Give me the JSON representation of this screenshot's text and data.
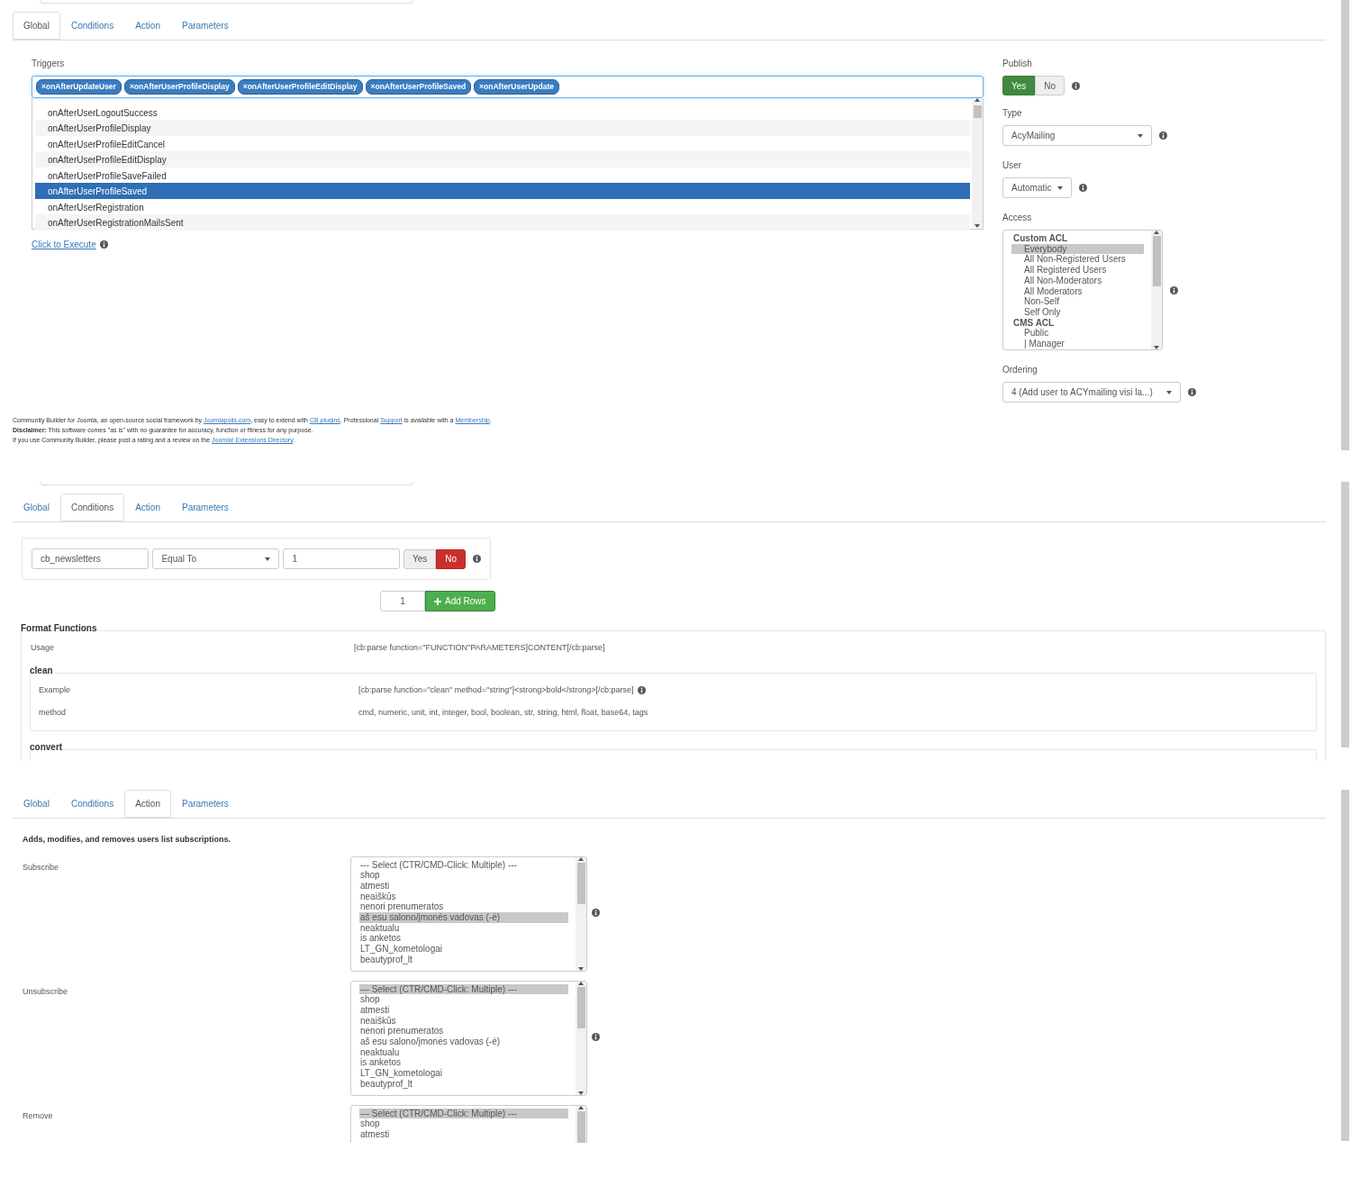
{
  "global_panel": {
    "tabs": [
      {
        "label": "Global",
        "selected": true
      },
      {
        "label": "Conditions",
        "selected": false
      },
      {
        "label": "Action",
        "selected": false
      },
      {
        "label": "Parameters",
        "selected": false
      }
    ],
    "triggers": {
      "label": "Triggers",
      "tags": [
        "×onAfterUpdateUser",
        "×onAfterUserProfileDisplay",
        "×onAfterUserProfileEditDisplay",
        "×onAfterUserProfileSaved",
        "×onAfterUserUpdate"
      ],
      "options": [
        {
          "label": "onAfterUserLogoutSuccess",
          "selected": false
        },
        {
          "label": "onAfterUserProfileDisplay",
          "selected": false
        },
        {
          "label": "onAfterUserProfileEditCancel",
          "selected": false
        },
        {
          "label": "onAfterUserProfileEditDisplay",
          "selected": false
        },
        {
          "label": "onAfterUserProfileSaveFailed",
          "selected": false
        },
        {
          "label": "onAfterUserProfileSaved",
          "selected": true
        },
        {
          "label": "onAfterUserRegistration",
          "selected": false
        },
        {
          "label": "onAfterUserRegistrationMailsSent",
          "selected": false
        }
      ]
    },
    "execute_link": "Click to Execute",
    "publish": {
      "label": "Publish",
      "options": [
        {
          "label": "Yes",
          "selected": true
        },
        {
          "label": "No",
          "selected": false
        }
      ]
    },
    "type": {
      "label": "Type",
      "value": "AcyMailing"
    },
    "user": {
      "label": "User",
      "value": "Automatic"
    },
    "access": {
      "label": "Access",
      "groups": [
        {
          "label": "Custom ACL",
          "options": [
            {
              "label": "Everybody",
              "selected": true
            },
            {
              "label": "All Non-Registered Users",
              "selected": false
            },
            {
              "label": "All Registered Users",
              "selected": false
            },
            {
              "label": "All Non-Moderators",
              "selected": false
            },
            {
              "label": "All Moderators",
              "selected": false
            },
            {
              "label": "Non-Self",
              "selected": false
            },
            {
              "label": "Self Only",
              "selected": false
            }
          ]
        },
        {
          "label": "CMS ACL",
          "options": [
            {
              "label": "Public",
              "selected": false
            },
            {
              "label": "| Manager",
              "selected": false
            }
          ]
        }
      ]
    },
    "ordering": {
      "label": "Ordering",
      "value": "4 (Add user to ACYmailing visi la...)"
    },
    "footer": [
      [
        {
          "kind": "text",
          "text": "Community Builder for Joomla, an open-source social framework by "
        },
        {
          "kind": "link",
          "text": "Joomlapolis.com"
        },
        {
          "kind": "text",
          "text": ", easy to extend with "
        },
        {
          "kind": "link",
          "text": "CB plugins"
        },
        {
          "kind": "text",
          "text": ". Professional "
        },
        {
          "kind": "link",
          "text": "Support"
        },
        {
          "kind": "text",
          "text": " is available with a "
        },
        {
          "kind": "link",
          "text": "Membership"
        },
        {
          "kind": "text",
          "text": "."
        }
      ],
      [
        {
          "kind": "text",
          "text": "**Disclaimer:** This software comes \"as is\" with no guarantee for accuracy, function or fitness for any purpose."
        }
      ],
      [
        {
          "kind": "text",
          "text": "If you use Community Builder, please post a rating and a review on the "
        },
        {
          "kind": "link",
          "text": "Joomla! Extensions Directory"
        },
        {
          "kind": "text",
          "text": "."
        }
      ]
    ]
  },
  "conditions_panel": {
    "tabs": [
      {
        "label": "Global",
        "selected": false
      },
      {
        "label": "Conditions",
        "selected": true
      },
      {
        "label": "Action",
        "selected": false
      },
      {
        "label": "Parameters",
        "selected": false
      }
    ],
    "condition": {
      "field": "cb_newsletters",
      "operator": "Equal To",
      "value": "1",
      "toggle": [
        {
          "label": "Yes",
          "selected": false
        },
        {
          "label": "No",
          "selected": true
        }
      ]
    },
    "add_rows": {
      "count": "1",
      "label": "Add Rows"
    },
    "format_functions": {
      "title": "Format Functions",
      "usage_label": "Usage",
      "usage_value": "[cb:parse function=\"FUNCTION\"PARAMETERS]CONTENT[/cb:parse]",
      "groups": [
        {
          "title": "clean",
          "rows": [
            {
              "label": "Example",
              "value": "[cb:parse function=\"clean\" method=\"string\"]<strong>bold</strong>[/cb:parse]",
              "info": true
            },
            {
              "label": "method",
              "value": "cmd, numeric, unit, int, integer, bool, boolean, str, string, html, float, base64, tags",
              "info": false
            }
          ]
        },
        {
          "title": "convert"
        }
      ]
    }
  },
  "action_panel": {
    "tabs": [
      {
        "label": "Global",
        "selected": false
      },
      {
        "label": "Conditions",
        "selected": false
      },
      {
        "label": "Action",
        "selected": true
      },
      {
        "label": "Parameters",
        "selected": false
      }
    ],
    "description": "Adds, modifies, and removes users list subscriptions.",
    "lists": [
      {
        "label": "Subscribe",
        "options": [
          {
            "label": "--- Select (CTR/CMD-Click: Multiple) ---",
            "selected": false
          },
          {
            "label": "shop",
            "selected": false
          },
          {
            "label": "atmesti",
            "selected": false
          },
          {
            "label": "neaiškūs",
            "selected": false
          },
          {
            "label": "nenori prenumeratos",
            "selected": false
          },
          {
            "label": "aš esu salono/įmonės vadovas (-ė)",
            "selected": true
          },
          {
            "label": "neaktualu",
            "selected": false
          },
          {
            "label": "is anketos",
            "selected": false
          },
          {
            "label": "LT_GN_kometologai",
            "selected": false
          },
          {
            "label": "beautyprof_lt",
            "selected": false
          }
        ]
      },
      {
        "label": "Unsubscribe",
        "options": [
          {
            "label": "--- Select (CTR/CMD-Click: Multiple) ---",
            "selected": true
          },
          {
            "label": "shop",
            "selected": false
          },
          {
            "label": "atmesti",
            "selected": false
          },
          {
            "label": "neaiškūs",
            "selected": false
          },
          {
            "label": "nenori prenumeratos",
            "selected": false
          },
          {
            "label": "aš esu salono/įmonės vadovas (-ė)",
            "selected": false
          },
          {
            "label": "neaktualu",
            "selected": false
          },
          {
            "label": "is anketos",
            "selected": false
          },
          {
            "label": "LT_GN_kometologai",
            "selected": false
          },
          {
            "label": "beautyprof_lt",
            "selected": false
          }
        ]
      },
      {
        "label": "Remove",
        "options": [
          {
            "label": "--- Select (CTR/CMD-Click: Multiple) ---",
            "selected": true
          },
          {
            "label": "shop",
            "selected": false
          },
          {
            "label": "atmesti",
            "selected": false
          }
        ]
      }
    ]
  }
}
